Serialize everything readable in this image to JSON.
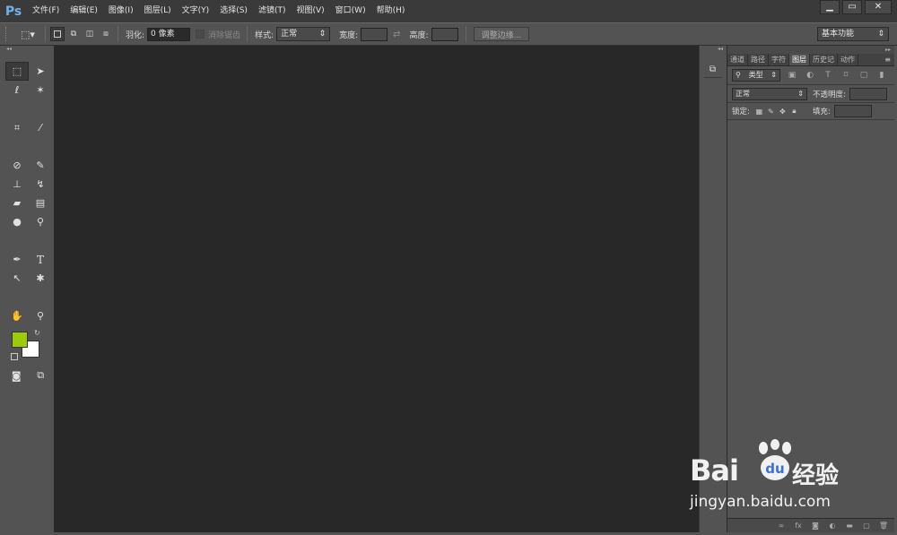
{
  "app": {
    "logo": "Ps"
  },
  "menu": [
    "文件(F)",
    "编辑(E)",
    "图像(I)",
    "图层(L)",
    "文字(Y)",
    "选择(S)",
    "滤镜(T)",
    "视图(V)",
    "窗口(W)",
    "帮助(H)"
  ],
  "window_controls": {
    "minimize": "▁",
    "maximize": "▭",
    "close": "✕"
  },
  "options_bar": {
    "feather_label": "羽化:",
    "feather_value": "0 像素",
    "antialias_label": "消除锯齿",
    "style_label": "样式:",
    "style_value": "正常",
    "width_label": "宽度:",
    "height_label": "高度:",
    "refine_edge": "调整边缘...",
    "workspace": "基本功能"
  },
  "panels": {
    "tabs": [
      "通道",
      "路径",
      "字符",
      "图层",
      "历史记",
      "动作"
    ],
    "active_tab": "图层",
    "filter_kind": "类型",
    "blend_mode": "正常",
    "opacity_label": "不透明度:",
    "lock_label": "锁定:",
    "fill_label": "填充:"
  },
  "colors": {
    "foreground": "#9ecb07",
    "background": "#ffffff"
  },
  "watermark": {
    "brand": "Bai",
    "brand_cn": "经验",
    "url": "jingyan.baidu.com"
  }
}
